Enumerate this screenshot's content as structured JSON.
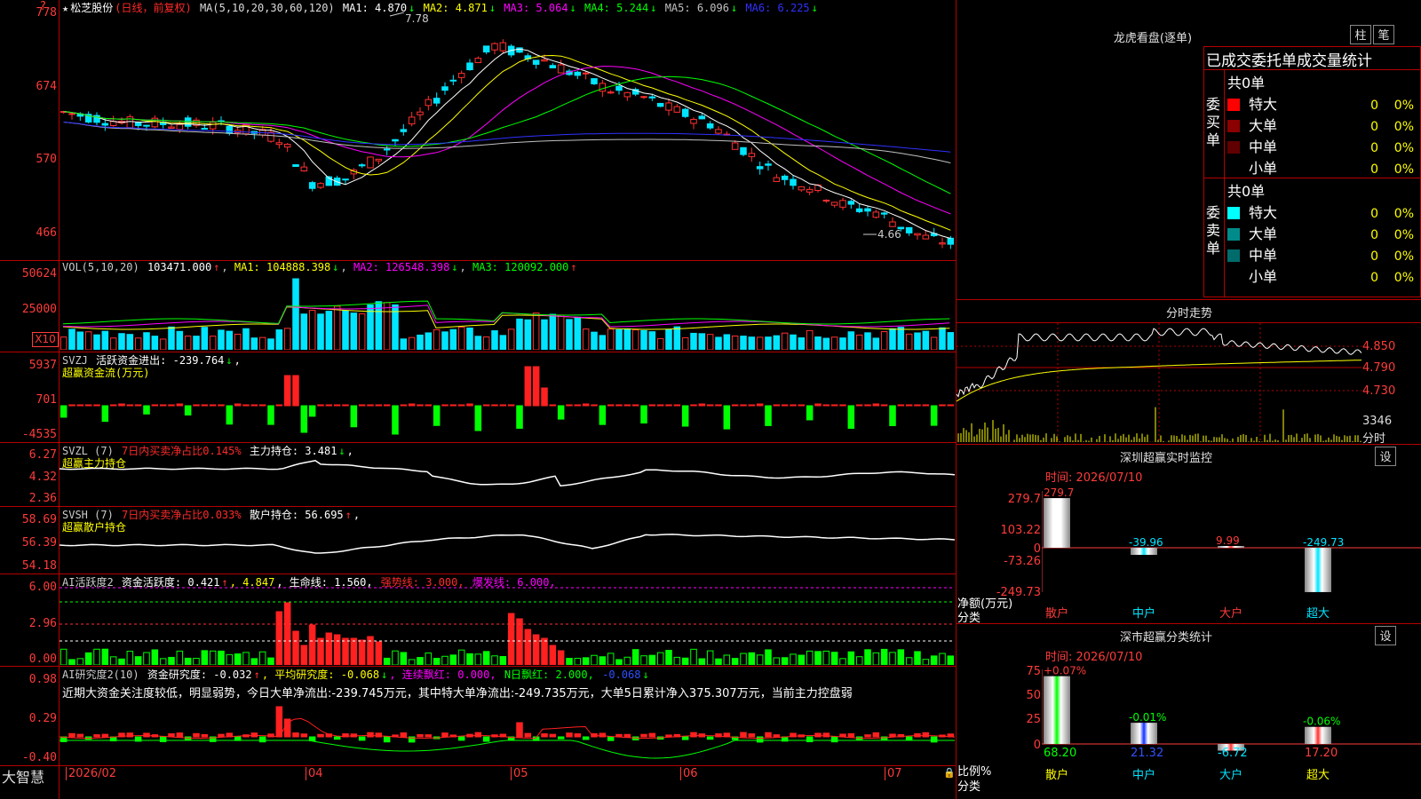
{
  "stock": {
    "name": "松芝股份",
    "mode": "(日线，前复权)",
    "ma_title": "MA(5,10,20,30,60,120)",
    "ma": [
      {
        "label": "MA1:",
        "value": "4.870",
        "arrow": "↓",
        "color": "#ffffff"
      },
      {
        "label": "MA2:",
        "value": "4.871",
        "arrow": "↓",
        "color": "#ffff00"
      },
      {
        "label": "MA3:",
        "value": "5.064",
        "arrow": "↓",
        "color": "#ff00ff"
      },
      {
        "label": "MA4:",
        "value": "5.244",
        "arrow": "↓",
        "color": "#00ff00"
      },
      {
        "label": "MA5:",
        "value": "6.096",
        "arrow": "↓",
        "color": "#c0c0c0"
      },
      {
        "label": "MA6:",
        "value": "6.225",
        "arrow": "↓",
        "color": "#3030ff"
      }
    ],
    "high_mark": "7.78",
    "low_mark": "4.66",
    "price_axis": [
      "778",
      "674",
      "570",
      "466"
    ]
  },
  "vol": {
    "title": "VOL(5,10,20)",
    "value": "103471.000",
    "arrow": "↑",
    "ma1": "MA1: 104888.398",
    "ma1_arrow": "↓",
    "ma2": "MA2: 126548.398",
    "ma2_arrow": "↓",
    "ma3": "MA3: 120092.000",
    "ma3_arrow": "↑",
    "axis": [
      "50624",
      "25000"
    ],
    "unit": "X10"
  },
  "svzj": {
    "title": "SVZJ",
    "label": "活跃资金进出: -239.764",
    "arrow": "↓",
    "comma": ",",
    "sub": "超赢资金流(万元)",
    "axis": [
      "5937",
      "701",
      "-4535"
    ]
  },
  "svzl": {
    "title": "SVZL (7)",
    "ratio": "7日内买卖净占比0.145%",
    "label": "主力持仓: 3.481",
    "arrow": "↓",
    "comma": ",",
    "sub": "超赢主力持仓",
    "axis": [
      "6.27",
      "4.32",
      "2.36"
    ]
  },
  "svsh": {
    "title": "SVSH (7)",
    "ratio": "7日内买卖净占比0.033%",
    "label": "散户持仓: 56.695",
    "arrow": "↑",
    "comma": ",",
    "sub": "超赢散户持仓",
    "axis": [
      "58.69",
      "56.39",
      "54.18"
    ]
  },
  "ai1": {
    "title": "AI活跃度2",
    "label": "资金活跃度: 0.421",
    "arrow": "↑",
    "v2": ", 4.847",
    "life": ", 生命线: 1.560,",
    "strong": "强势线: 3.000,",
    "burst": "爆发线: 6.000,",
    "axis": [
      "6.00",
      "2.96",
      "0.00"
    ]
  },
  "ai2": {
    "title": "AI研究度2(10)",
    "label": "资金研究度: -0.032",
    "arrow": "↑",
    "avg": ", 平均研究度: -0.068",
    "avg_arrow": "↓",
    "lianxu": ", 连续飘红: 0.000,",
    "nday": "N日飘红: 2.000,",
    "neg": "-0.068",
    "neg_arrow": "↓",
    "comment": "近期大资金关注度较低，明显弱势，今日大单净流出:-239.745万元，其中特大单净流出:-249.735万元，大单5日累计净入375.307万元，当前主力控盘弱",
    "axis": [
      "0.98",
      "0.29",
      "-0.40"
    ]
  },
  "footer": {
    "brand": "大智慧",
    "dates": [
      "2026/02",
      "04",
      "05",
      "06",
      "07"
    ]
  },
  "lhb": {
    "title": "龙虎看盘(逐单)",
    "btn1": "柱",
    "btn2": "笔",
    "header": "已成交委托单成交量统计",
    "buy_side": "委买单",
    "sell_side": "委卖单",
    "buy_total": "共0单",
    "sell_total": "共0单",
    "rows": [
      {
        "name": "特大",
        "count": "0",
        "pct": "0%"
      },
      {
        "name": "大单",
        "count": "0",
        "pct": "0%"
      },
      {
        "name": "中单",
        "count": "0",
        "pct": "0%"
      },
      {
        "name": "小单",
        "count": "0",
        "pct": "0%"
      }
    ],
    "buy_colors": [
      "#ff0000",
      "#8b0000",
      "#600000",
      ""
    ],
    "sell_colors": [
      "#00ffff",
      "#008b8b",
      "#006b6b",
      ""
    ]
  },
  "intraday": {
    "title": "分时走势",
    "axis": [
      "4.850",
      "4.790",
      "4.730"
    ],
    "vol_label": "3346",
    "vol_unit": "分时"
  },
  "szmon": {
    "title": "深圳超赢实时监控",
    "btn": "设",
    "time": "时间: 2026/07/10",
    "axis": [
      "279.7",
      "103.22",
      "0",
      "-73.26",
      "-249.73"
    ],
    "ylabel": "净额(万元)",
    "xlabel": "分类",
    "cats": [
      "散户",
      "中户",
      "大户",
      "超大"
    ],
    "values": [
      279.7,
      -39.96,
      9.99,
      -249.73
    ],
    "labels": [
      "279.7",
      "-39.96",
      "9.99",
      "-249.73"
    ]
  },
  "szcls": {
    "title": "深市超赢分类统计",
    "btn": "设",
    "time": "时间: 2026/07/10",
    "axis": [
      "75",
      "50",
      "25",
      "0"
    ],
    "ylabel": "比例%",
    "xlabel": "分类",
    "cats": [
      "散户",
      "中户",
      "大户",
      "超大"
    ],
    "top_labels": [
      "+0.07%",
      "-0.01%",
      "",
      "-0.06%"
    ],
    "values": [
      68.2,
      21.32,
      -6.72,
      17.2
    ],
    "labels": [
      "68.20",
      "21.32",
      "-6.72",
      "17.20"
    ]
  }
}
